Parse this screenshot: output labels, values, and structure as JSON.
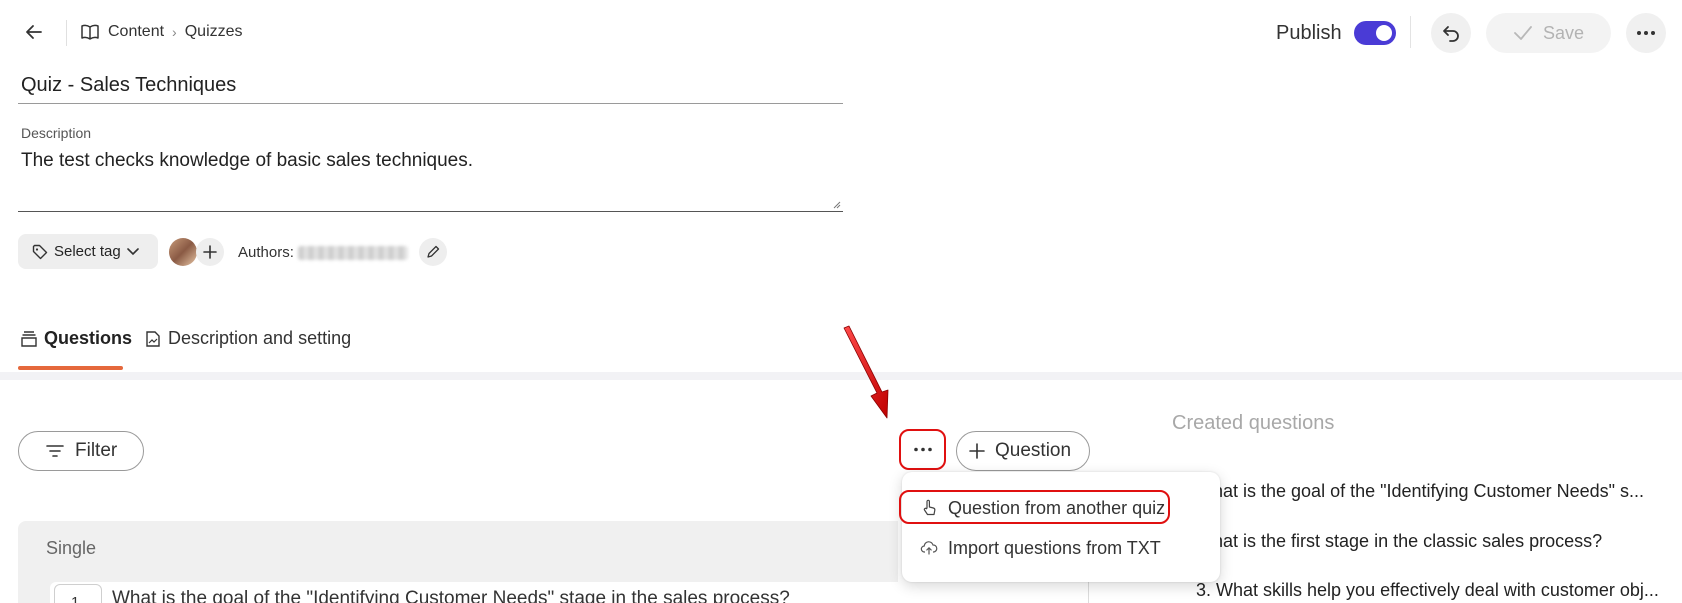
{
  "header": {
    "breadcrumb": [
      "Content",
      "Quizzes"
    ],
    "publish_label": "Publish",
    "publish_on": true,
    "save_label": "Save"
  },
  "quiz": {
    "title": "Quiz  - Sales Techniques",
    "description_label": "Description",
    "description": "The test checks knowledge of basic sales techniques.",
    "select_tag_label": "Select tag",
    "authors_label": "Authors:"
  },
  "tabs": [
    {
      "label": "Questions",
      "active": true
    },
    {
      "label": "Description and setting",
      "active": false
    }
  ],
  "toolbar": {
    "filter_label": "Filter",
    "question_label": "Question"
  },
  "menu": {
    "items": [
      "Question from another quiz",
      "Import questions from TXT"
    ]
  },
  "questions": {
    "group_label": "Single",
    "first": {
      "number": "1",
      "text": "What is the goal of the \"Identifying Customer Needs\" stage in the sales process?"
    }
  },
  "created": {
    "title": "Created questions",
    "items": [
      "What is the goal of the \"Identifying Customer Needs\" s...",
      "What is the first stage in the classic sales process?",
      "3. What skills help you effectively deal with customer obj..."
    ]
  },
  "colors": {
    "accent": "#4a3bd6",
    "tab_underline": "#e5683c",
    "annotation": "#e01010"
  },
  "icons": {
    "back": "arrow-left-icon",
    "breadcrumb": "book-icon",
    "undo": "undo-icon",
    "save": "check-icon",
    "more": "more-horizontal-icon",
    "tag": "tag-icon",
    "filter": "filter-icon",
    "add": "plus-icon",
    "from_quiz": "hand-pointer-icon",
    "import": "cloud-upload-icon"
  }
}
